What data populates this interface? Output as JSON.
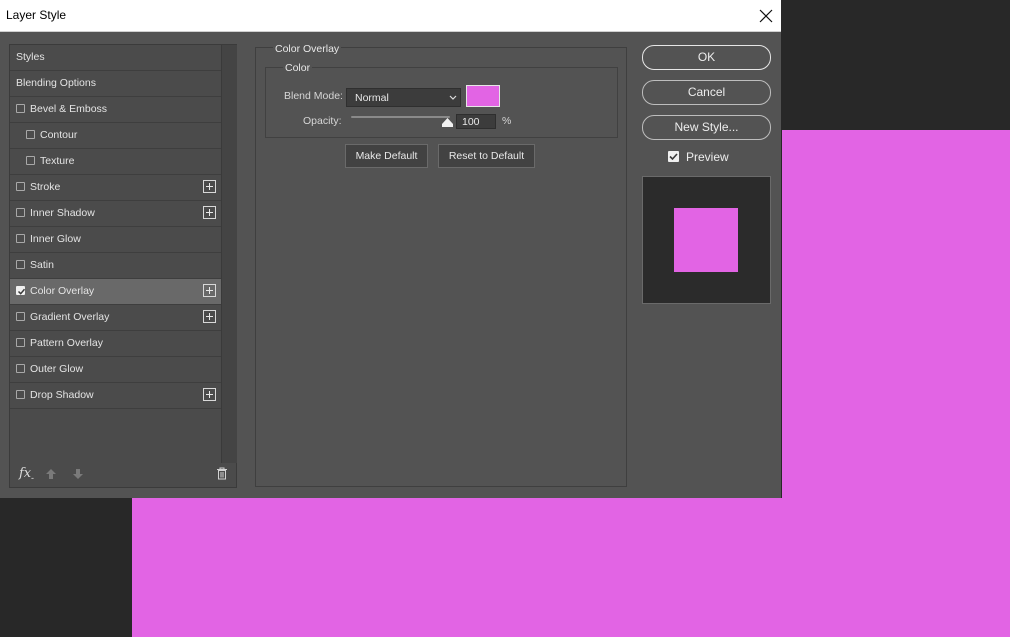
{
  "window": {
    "title": "Layer Style",
    "close_glyph": "×"
  },
  "colors": {
    "overlay": "#e264e4",
    "dialog_bg": "#535353",
    "canvas_bg": "#282828"
  },
  "styles_panel": {
    "items": [
      {
        "label": "Styles",
        "checkbox": false,
        "checked": false,
        "plus": false,
        "selected": false
      },
      {
        "label": "Blending Options",
        "checkbox": false,
        "checked": false,
        "plus": false,
        "selected": false
      },
      {
        "label": "Bevel & Emboss",
        "checkbox": true,
        "checked": false,
        "plus": false,
        "selected": false
      },
      {
        "label": "Contour",
        "checkbox": true,
        "checked": false,
        "plus": false,
        "selected": false,
        "indent": true
      },
      {
        "label": "Texture",
        "checkbox": true,
        "checked": false,
        "plus": false,
        "selected": false,
        "indent": true
      },
      {
        "label": "Stroke",
        "checkbox": true,
        "checked": false,
        "plus": true,
        "selected": false
      },
      {
        "label": "Inner Shadow",
        "checkbox": true,
        "checked": false,
        "plus": true,
        "selected": false
      },
      {
        "label": "Inner Glow",
        "checkbox": true,
        "checked": false,
        "plus": false,
        "selected": false
      },
      {
        "label": "Satin",
        "checkbox": true,
        "checked": false,
        "plus": false,
        "selected": false
      },
      {
        "label": "Color Overlay",
        "checkbox": true,
        "checked": true,
        "plus": true,
        "selected": true
      },
      {
        "label": "Gradient Overlay",
        "checkbox": true,
        "checked": false,
        "plus": true,
        "selected": false
      },
      {
        "label": "Pattern Overlay",
        "checkbox": true,
        "checked": false,
        "plus": false,
        "selected": false
      },
      {
        "label": "Outer Glow",
        "checkbox": true,
        "checked": false,
        "plus": false,
        "selected": false
      },
      {
        "label": "Drop Shadow",
        "checkbox": true,
        "checked": false,
        "plus": true,
        "selected": false
      }
    ],
    "footer": {
      "fx_label": "fx",
      "fx_sub": "-",
      "icons": [
        "fx-icon",
        "move-up-icon",
        "move-down-icon",
        "trash-icon"
      ]
    }
  },
  "color_overlay": {
    "section_title": "Color Overlay",
    "group_title": "Color",
    "blend_mode_label": "Blend Mode:",
    "blend_mode_value": "Normal",
    "opacity_label": "Opacity:",
    "opacity_value": "100",
    "opacity_percent": 100,
    "percent_sign": "%",
    "make_default_label": "Make Default",
    "reset_default_label": "Reset to Default"
  },
  "actions": {
    "ok_label": "OK",
    "cancel_label": "Cancel",
    "new_style_label": "New Style...",
    "preview_label": "Preview",
    "preview_checked": true
  }
}
